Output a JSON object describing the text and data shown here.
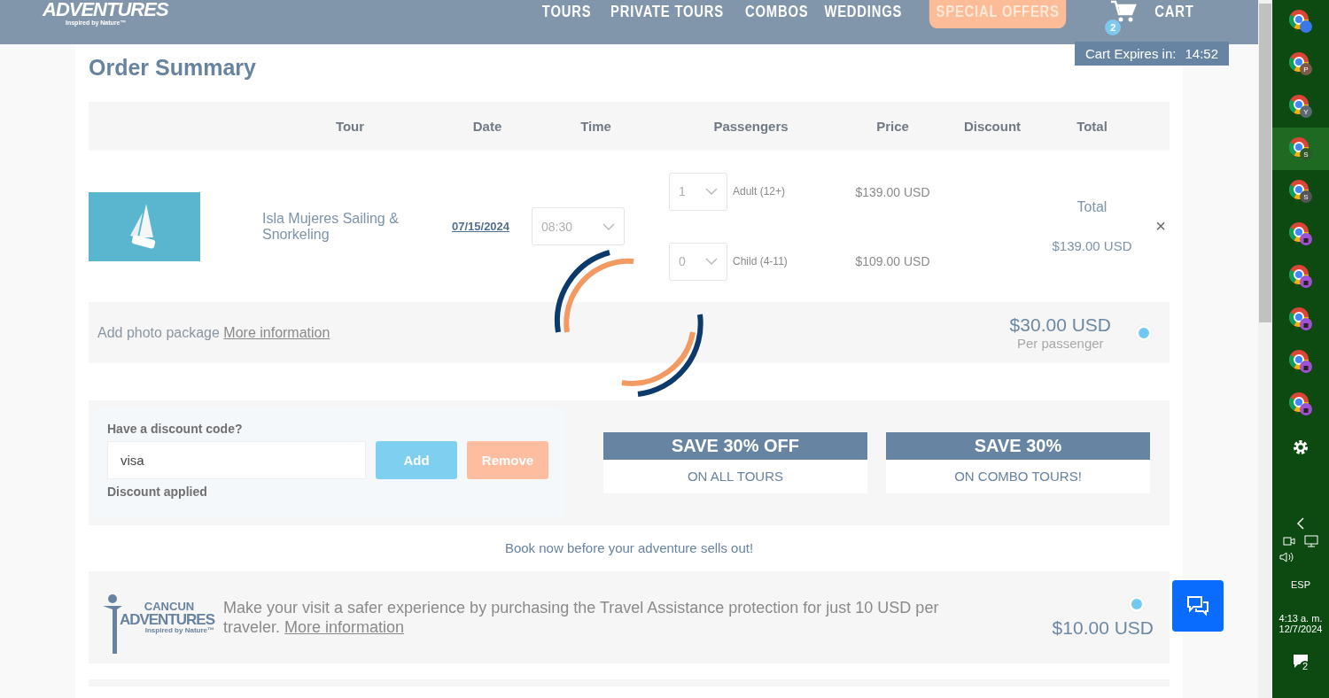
{
  "header": {
    "logo": {
      "name": "ADVENTURES",
      "tagline": "Inspired by Nature™"
    },
    "nav": [
      {
        "label": "TOURS",
        "kind": "link"
      },
      {
        "label": "PRIVATE TOURS",
        "kind": "link"
      },
      {
        "label": "COMBOS",
        "kind": "link"
      },
      {
        "label": "WEDDINGS",
        "kind": "link"
      },
      {
        "label": "SPECIAL OFFERS",
        "kind": "highlight"
      }
    ],
    "cart": {
      "label": "CART",
      "count": "2"
    },
    "cart_expires": {
      "label": "Cart Expires in:",
      "time": "14:52"
    }
  },
  "title": "Order Summary",
  "table": {
    "columns": [
      "Tour",
      "Date",
      "Time",
      "Passengers",
      "Price",
      "Discount",
      "Total"
    ],
    "rows": [
      {
        "tour": "Isla Mujeres Sailing & Snorkeling",
        "date": "07/15/2024",
        "time": "08:30",
        "passengers": [
          {
            "count": "1",
            "type": "Adult (12+)",
            "price": "$139.00 USD"
          },
          {
            "count": "0",
            "type": "Child (4-11)",
            "price": "$109.00 USD"
          }
        ],
        "total_label": "Total",
        "total": "$139.00 USD",
        "remove": "×"
      }
    ]
  },
  "loading": true,
  "photo_package": {
    "text": "Add photo package",
    "link": "More information",
    "price": "$30.00 USD",
    "note": "Per passenger",
    "selected": true
  },
  "discount": {
    "label": "Have a discount code?",
    "value": "visa",
    "add": "Add",
    "remove": "Remove",
    "status": "Discount applied"
  },
  "promos": [
    {
      "title": "SAVE 30% OFF",
      "subtitle": "ON ALL TOURS"
    },
    {
      "title": "SAVE 30%",
      "subtitle": "ON COMBO TOURS!"
    }
  ],
  "urgency": "Book now before your adventure sells out!",
  "assistance": {
    "logo": {
      "top": "CANCUN",
      "name": "ADVENTURES",
      "tagline": "Inspired by Nature™"
    },
    "text": "Make your visit a safer experience by purchasing the Travel Assistance protection for just 10 USD per traveler.",
    "link": "More information",
    "price": "$10.00 USD",
    "selected": true
  },
  "taskbar": {
    "apps": [
      {
        "kind": "people",
        "selected": false
      },
      {
        "badge": "P",
        "kind": "letter",
        "selected": false
      },
      {
        "badge": "Y",
        "kind": "letter",
        "selected": false
      },
      {
        "badge": "S",
        "kind": "letter",
        "selected": true
      },
      {
        "badge": "S",
        "kind": "letter",
        "selected": false
      },
      {
        "kind": "lock",
        "selected": false
      },
      {
        "kind": "lock",
        "selected": false
      },
      {
        "kind": "lock",
        "selected": false
      },
      {
        "kind": "lock",
        "selected": false
      },
      {
        "kind": "lock",
        "selected": false
      }
    ],
    "language": "ESP",
    "time": "4:13 a. m.",
    "date": "12/7/2024",
    "notifications": "2"
  }
}
